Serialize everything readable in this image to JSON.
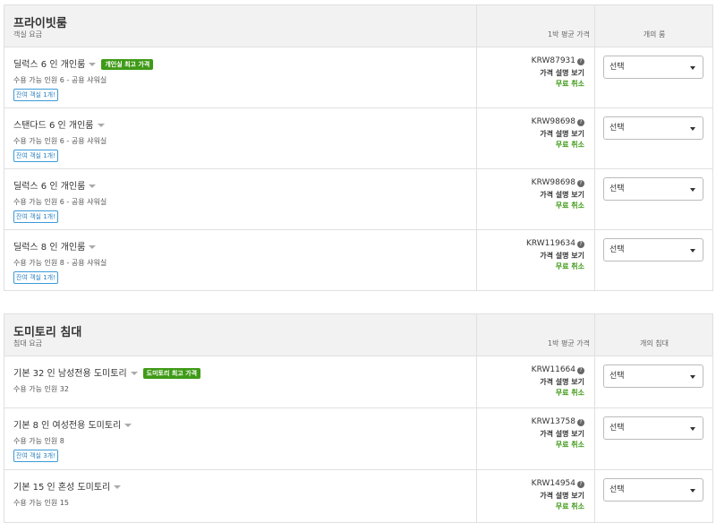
{
  "private_section": {
    "title": "프라이빗룸",
    "subtitle": "객실 요금",
    "col_price": "1박 평균 가격",
    "col_select": "개의 룸",
    "rooms": [
      {
        "name": "딜럭스 6 인 개인룸",
        "badge": "개인실 최고 가격",
        "capacity": "수용 가능 인원 6 - 공용 샤워실",
        "remaining": "잔여 객실 1개!",
        "price": "KRW87931",
        "explain": "가격 설명 보기",
        "cancel": "무료 취소",
        "select": "선택"
      },
      {
        "name": "스탠다드 6 인 개인룸",
        "badge": "",
        "capacity": "수용 가능 인원 6 - 공용 샤워실",
        "remaining": "잔여 객실 1개!",
        "price": "KRW98698",
        "explain": "가격 설명 보기",
        "cancel": "무료 취소",
        "select": "선택"
      },
      {
        "name": "딜럭스 6 인 개인룸",
        "badge": "",
        "capacity": "수용 가능 인원 6 - 공용 샤워실",
        "remaining": "잔여 객실 1개!",
        "price": "KRW98698",
        "explain": "가격 설명 보기",
        "cancel": "무료 취소",
        "select": "선택"
      },
      {
        "name": "딜럭스 8 인 개인룸",
        "badge": "",
        "capacity": "수용 가능 인원 8 - 공용 샤워실",
        "remaining": "잔여 객실 1개!",
        "price": "KRW119634",
        "explain": "가격 설명 보기",
        "cancel": "무료 취소",
        "select": "선택"
      }
    ]
  },
  "dorm_section": {
    "title": "도미토리 침대",
    "subtitle": "침대 요금",
    "col_price": "1박 평균 가격",
    "col_select": "개의 침대",
    "rooms": [
      {
        "name": "기본 32 인 남성전용 도미토리",
        "badge": "도미토리 최고 가격",
        "capacity": "수용 가능 인원 32",
        "remaining": "",
        "price": "KRW11664",
        "explain": "가격 설명 보기",
        "cancel": "무료 취소",
        "select": "선택"
      },
      {
        "name": "기본 8 인 여성전용 도미토리",
        "badge": "",
        "capacity": "수용 가능 인원 8",
        "remaining": "잔여 객실 3개!",
        "price": "KRW13758",
        "explain": "가격 설명 보기",
        "cancel": "무료 취소",
        "select": "선택"
      },
      {
        "name": "기본 15 인 혼성 도미토리",
        "badge": "",
        "capacity": "수용 가능 인원 15",
        "remaining": "",
        "price": "KRW14954",
        "explain": "가격 설명 보기",
        "cancel": "무료 취소",
        "select": "선택"
      }
    ]
  },
  "colors": {
    "accent_green": "#3f9a17",
    "remaining_blue": "#2a7fc0",
    "header_bg": "#f2f2f2"
  },
  "icons": {
    "info": "question-circle-icon",
    "dropdown": "caret-down-icon"
  }
}
